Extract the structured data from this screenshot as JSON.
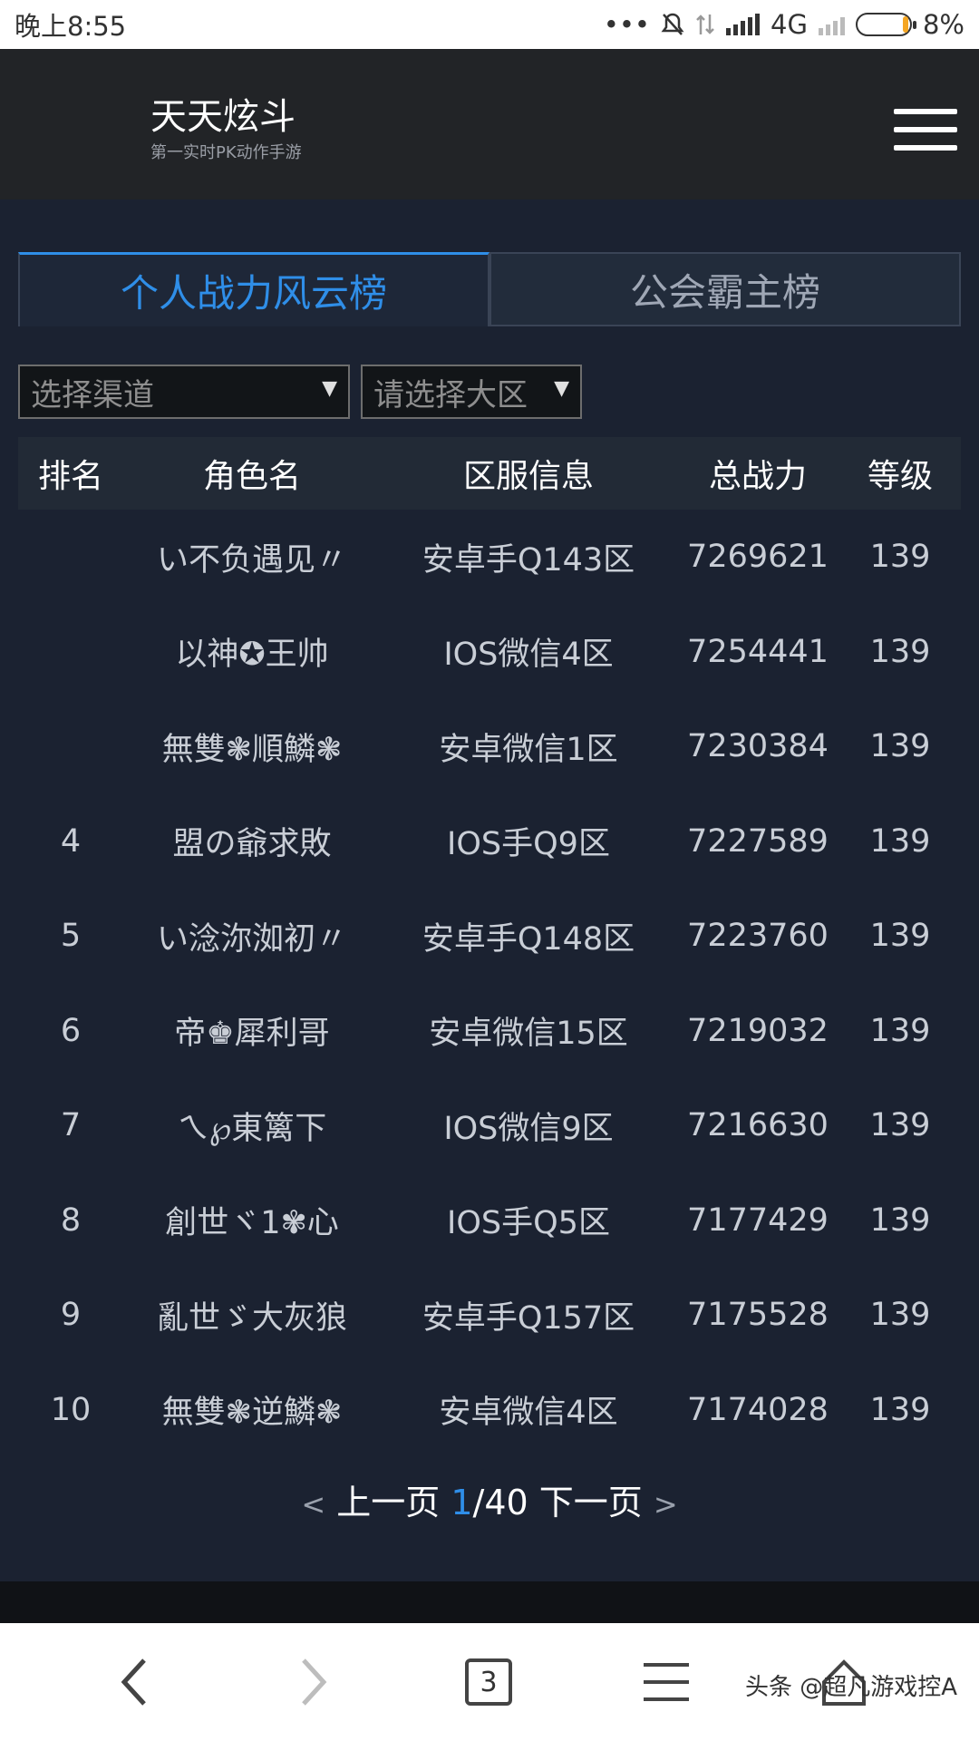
{
  "status_bar": {
    "time": "晚上8:55",
    "network": "4G",
    "battery": "8%",
    "dots": "•••"
  },
  "header": {
    "title": "天天炫斗",
    "subtitle": "第一实时PK动作手游"
  },
  "tabs": [
    {
      "label": "个人战力风云榜",
      "active": true
    },
    {
      "label": "公会霸主榜",
      "active": false
    }
  ],
  "filters": {
    "channel": "选择渠道",
    "region": "请选择大区"
  },
  "table": {
    "headers": [
      "排名",
      "角色名",
      "区服信息",
      "总战力",
      "等级"
    ],
    "rows": [
      {
        "rank": "",
        "name": "い不负遇见〃",
        "server": "安卓手Q143区",
        "power": "7269621",
        "level": "139"
      },
      {
        "rank": "",
        "name": "以神✪王帅",
        "server": "IOS微信4区",
        "power": "7254441",
        "level": "139"
      },
      {
        "rank": "",
        "name": "無雙❃順鱗❃",
        "server": "安卓微信1区",
        "power": "7230384",
        "level": "139"
      },
      {
        "rank": "4",
        "name": "盟の爺求敗",
        "server": "IOS手Q9区",
        "power": "7227589",
        "level": "139"
      },
      {
        "rank": "5",
        "name": "い淰沵洳初〃",
        "server": "安卓手Q148区",
        "power": "7223760",
        "level": "139"
      },
      {
        "rank": "6",
        "name": "帝♚犀利哥",
        "server": "安卓微信15区",
        "power": "7219032",
        "level": "139"
      },
      {
        "rank": "7",
        "name": "ㄟ℘東篱下",
        "server": "IOS微信9区",
        "power": "7216630",
        "level": "139"
      },
      {
        "rank": "8",
        "name": "創世ヾ1✾心",
        "server": "IOS手Q5区",
        "power": "7177429",
        "level": "139"
      },
      {
        "rank": "9",
        "name": "亂世ゞ大灰狼",
        "server": "安卓手Q157区",
        "power": "7175528",
        "level": "139"
      },
      {
        "rank": "10",
        "name": "無雙❃逆鱗❃",
        "server": "安卓微信4区",
        "power": "7174028",
        "level": "139"
      }
    ]
  },
  "pagination": {
    "prev_chevron": "<",
    "prev": "上一页",
    "current": "1",
    "total": "/40",
    "next": "下一页",
    "next_chevron": ">"
  },
  "browser_bar": {
    "tab_count": "3",
    "watermark": "头条 @超凡游戏控A"
  }
}
